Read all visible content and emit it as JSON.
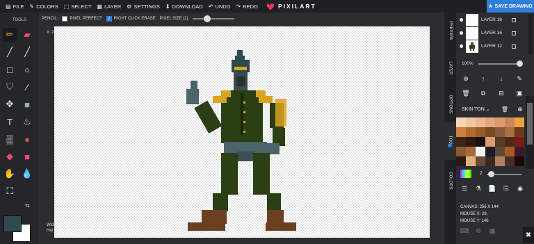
{
  "topbar": {
    "menu": [
      {
        "icon": "file-icon",
        "label": "FILE"
      },
      {
        "icon": "palette-icon",
        "label": "COLORS"
      },
      {
        "icon": "select-icon",
        "label": "SELECT"
      },
      {
        "icon": "layer-icon",
        "label": "LAYER"
      },
      {
        "icon": "gear-icon",
        "label": "SETTINGS"
      },
      {
        "icon": "download-icon",
        "label": "DOWNLOAD"
      },
      {
        "icon": "undo-icon",
        "label": "UNDO"
      },
      {
        "icon": "redo-icon",
        "label": "REDO"
      }
    ],
    "logo_text": "PIXILART",
    "save_label": "SAVE DRAWING"
  },
  "optbar": {
    "tool_label": "PENCIL:",
    "pixel_perfect": "PIXEL PERFECT",
    "right_click_erase": "RIGHT CLICK ERASE",
    "pixel_size": "PIXEL SIZE (2)"
  },
  "tools": {
    "title": "TOOLS"
  },
  "canvas": {
    "x_label": "X: 2",
    "width_label": "Wid",
    "height_label": "Hei"
  },
  "sidetabs": [
    "PREVIEW",
    "LAYER",
    "OPTIONS",
    "TOOL",
    "COLORS"
  ],
  "layers": [
    "LAYER 18",
    "LAYER 16",
    "LAYER 12"
  ],
  "opacity": "100%",
  "palette_name": "SKIN TON",
  "palette_colors": [
    "#f5d5b5",
    "#f0c8a0",
    "#eab892",
    "#e3a87c",
    "#d99a6c",
    "#c8875a",
    "#f0a040",
    "#c8803c",
    "#b06a2c",
    "#9a5a24",
    "#7a4a24",
    "#8a5a3c",
    "#a8703c",
    "#6a3a1c",
    "#3a2418",
    "#2a1a10",
    "#1a1010",
    "#d8a070",
    "#5a3a24",
    "#4a2a1c",
    "#7a1a1a",
    "#8a5a34",
    "#a86a3c",
    "#f2f2f2",
    "#1a1a2a",
    "#5a4a3a",
    "#aa5a2a",
    "#3a1a2a",
    "#2a1a12",
    "#e0b080",
    "#6a4a34",
    "#3a2a20",
    "#b08060",
    "#4a3024",
    "#1a0a0a"
  ],
  "brush_size": "2",
  "info": {
    "canvas": "CANVAS: 256 X 144",
    "mouse_x": "MOUSE X: 28,",
    "mouse_y": "MOUSE Y: 146"
  }
}
